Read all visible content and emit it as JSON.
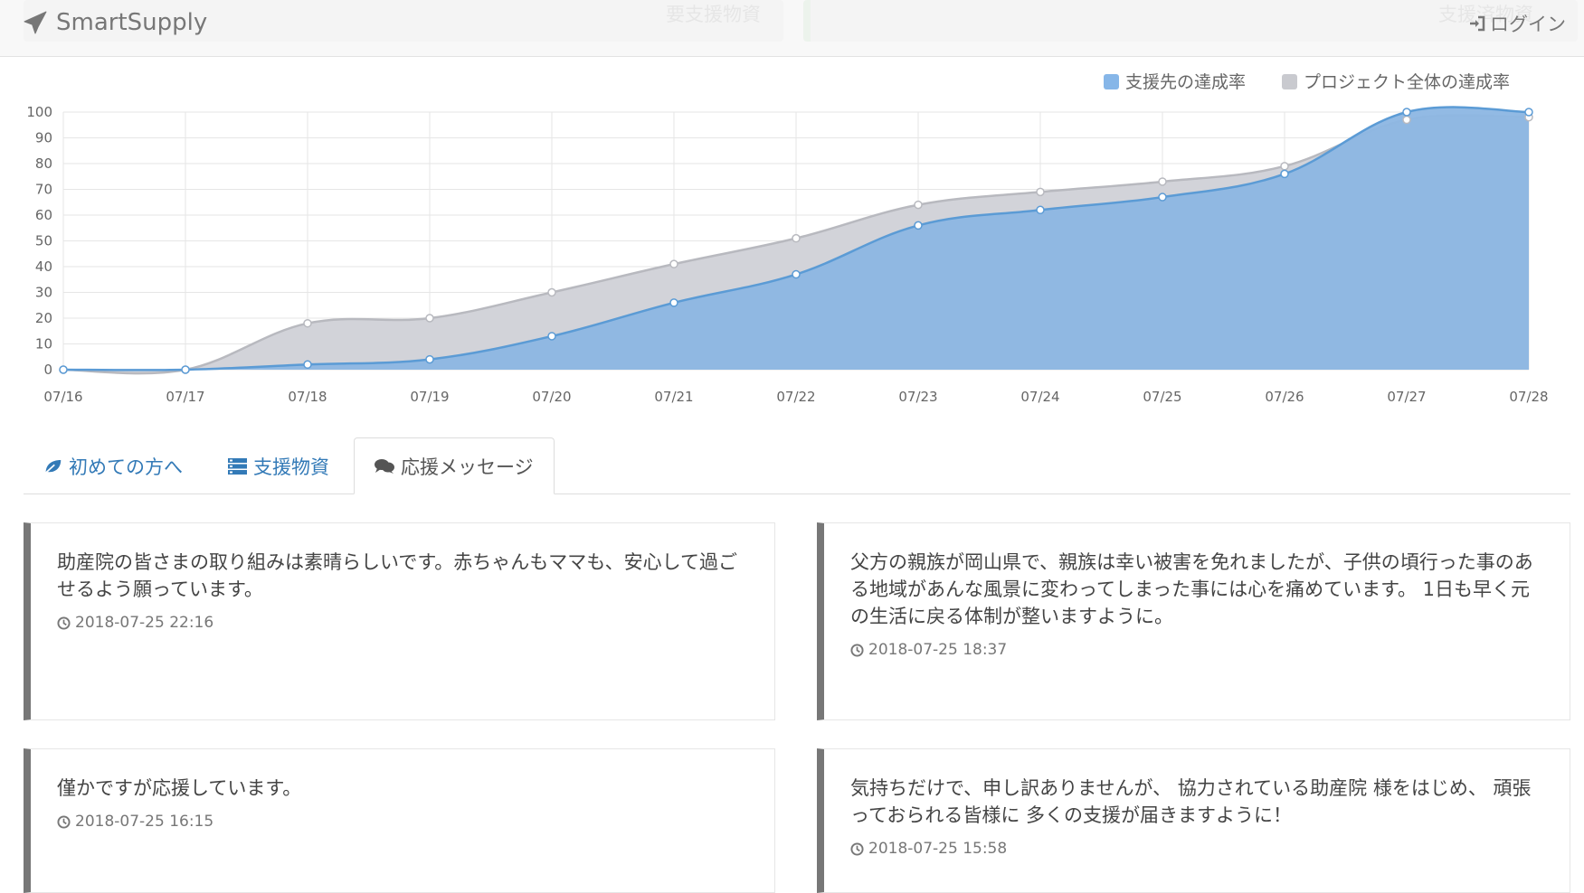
{
  "navbar": {
    "brand": "SmartSupply",
    "login": "ログイン",
    "ghost_left": "要支援物資",
    "ghost_right": "支援済物資"
  },
  "chart_data": {
    "type": "area",
    "categories": [
      "07/16",
      "07/17",
      "07/18",
      "07/19",
      "07/20",
      "07/21",
      "07/22",
      "07/23",
      "07/24",
      "07/25",
      "07/26",
      "07/27",
      "07/28"
    ],
    "series": [
      {
        "name": "支援先の達成率",
        "color": "#7fb0e0",
        "values": [
          0,
          0,
          2,
          4,
          13,
          26,
          37,
          56,
          62,
          67,
          76,
          100,
          100
        ]
      },
      {
        "name": "プロジェクト全体の達成率",
        "color": "#cccdd3",
        "values": [
          0,
          0,
          18,
          20,
          30,
          41,
          51,
          64,
          69,
          73,
          79,
          97,
          98
        ]
      }
    ],
    "y_ticks": [
      "0",
      "10",
      "20",
      "30",
      "40",
      "50",
      "60",
      "70",
      "80",
      "90",
      "100"
    ],
    "ylim": [
      0,
      100
    ],
    "grid": true,
    "legend": "top-right"
  },
  "tabs": [
    {
      "label": "初めての方へ",
      "icon": "leaf-icon"
    },
    {
      "label": "支援物資",
      "icon": "list-icon"
    },
    {
      "label": "応援メッセージ",
      "icon": "comments-icon"
    }
  ],
  "messages": [
    {
      "text": "助産院の皆さまの取り組みは素晴らしいです。赤ちゃんもママも、安心して過ごせるよう願っています。",
      "time": "2018-07-25 22:16"
    },
    {
      "text": "父方の親族が岡山県で、親族は幸い被害を免れましたが、子供の頃行った事のある地域があんな風景に変わってしまった事には心を痛めています。 1日も早く元の生活に戻る体制が整いますように。",
      "time": "2018-07-25 18:37"
    },
    {
      "text": "僅かですが応援しています。",
      "time": "2018-07-25 16:15"
    },
    {
      "text": "気持ちだけで、申し訳ありませんが、 協力されている助産院 様をはじめ、 頑張っておられる皆様に 多くの支援が届きますように！",
      "time": "2018-07-25 15:58"
    }
  ]
}
